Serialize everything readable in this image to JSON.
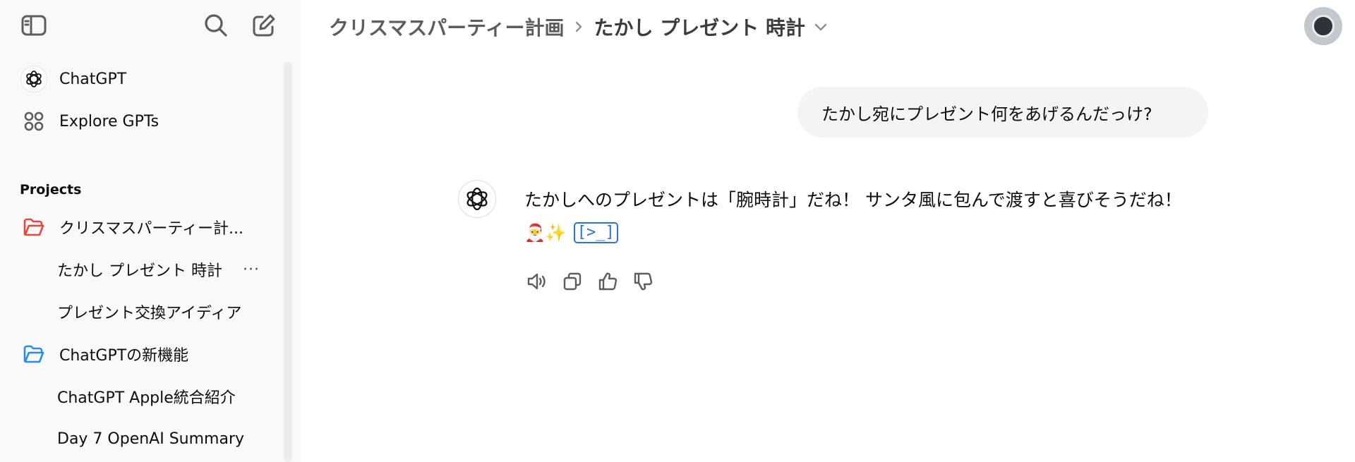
{
  "sidebar": {
    "gpt_label": "ChatGPT",
    "explore_label": "Explore GPTs",
    "projects_title": "Projects",
    "projects": [
      {
        "name": "クリスマスパーティー計...",
        "color": "#e8453c",
        "chats": [
          "たかし プレゼント 時計",
          "プレゼント交換アイディア"
        ]
      },
      {
        "name": "ChatGPTの新機能",
        "color": "#2a8be8",
        "chats": [
          "ChatGPT Apple統合紹介",
          "Day 7 OpenAI Summary"
        ]
      }
    ],
    "more_label": "···"
  },
  "header": {
    "project": "クリスマスパーティー計画",
    "separator": "›",
    "chat_title": "たかし プレゼント 時計"
  },
  "conversation": {
    "user_message": "たかし宛にプレゼント何をあげるんだっけ?",
    "assistant_message": "たかしへのプレゼントは「腕時計」だね！ サンタ風に包んで渡すと喜びそうだね！",
    "assistant_emoji": "🎅✨",
    "tool_chip": "[>_]"
  },
  "icons": [
    "sidebar-toggle-icon",
    "search-icon",
    "new-chat-icon",
    "openai-logo-icon",
    "grid-icon",
    "folder-icon",
    "chevron-right-icon",
    "chevron-down-icon",
    "speaker-icon",
    "copy-icon",
    "thumbs-up-icon",
    "thumbs-down-icon"
  ]
}
